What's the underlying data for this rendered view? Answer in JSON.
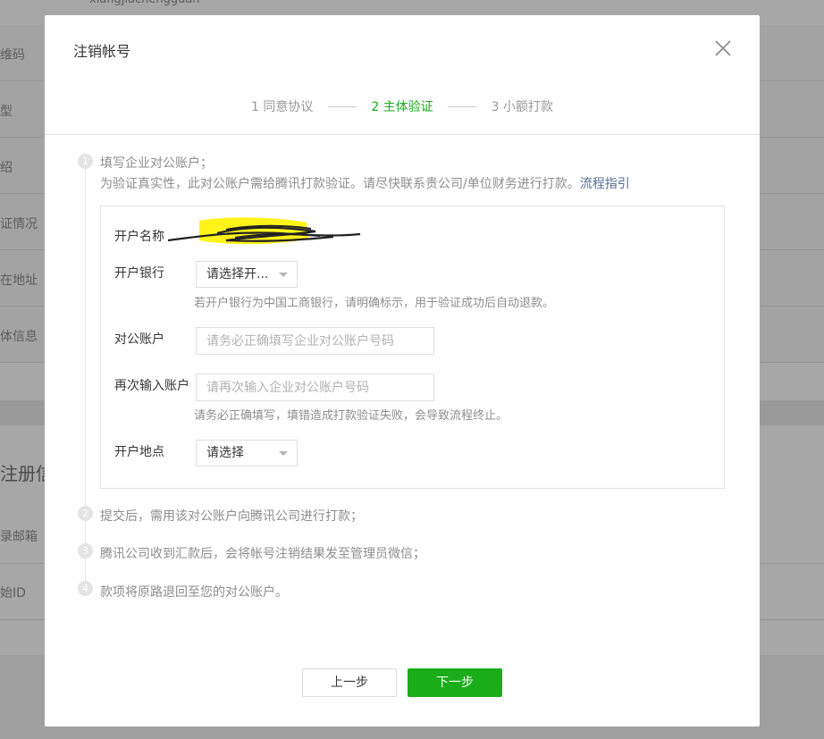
{
  "background": {
    "top_value": "xiangjiachengguan",
    "labels": [
      "维码",
      "型",
      "绍",
      "证情况",
      "在地址",
      "体信息"
    ],
    "section_heading": "注册信",
    "lower_labels": [
      "录邮箱",
      "始ID"
    ]
  },
  "dialog": {
    "title": "注销帐号",
    "close_icon": "close-icon",
    "steps": [
      {
        "label": "1 同意协议",
        "active": false
      },
      {
        "label": "2 主体验证",
        "active": true
      },
      {
        "label": "3 小额打款",
        "active": false
      }
    ],
    "process": {
      "step1": {
        "number": "1",
        "title": "填写企业对公账户；",
        "desc": "为验证真实性，此对公账户需给腾讯打款验证。请尽快联系贵公司/单位财务进行打款。",
        "link": "流程指引"
      },
      "step2": {
        "number": "2",
        "text": "提交后，需用该对公账户向腾讯公司进行打款；"
      },
      "step3": {
        "number": "3",
        "text": "腾讯公司收到汇款后，会将帐号注销结果发至管理员微信；"
      },
      "step4": {
        "number": "4",
        "text": "款项将原路退回至您的对公账户。"
      }
    },
    "form": {
      "account_name_label": "开户名称",
      "bank_label": "开户银行",
      "bank_select": "请选择开...",
      "bank_hint": "若开户银行为中国工商银行，请明确标示，用于验证成功后自动退款。",
      "account_label": "对公账户",
      "account_placeholder": "请务必正确填写企业对公账户号码",
      "reenter_label": "再次输入账户",
      "reenter_placeholder": "请再次输入企业对公账户号码",
      "reenter_hint": "请务必正确填写，填错造成打款验证失败，会导致流程终止。",
      "location_label": "开户地点",
      "location_select": "请选择"
    },
    "buttons": {
      "prev": "上一步",
      "next": "下一步"
    },
    "colors": {
      "accent": "#1aad19",
      "link": "#576b95",
      "highlight": "#fff200"
    }
  }
}
